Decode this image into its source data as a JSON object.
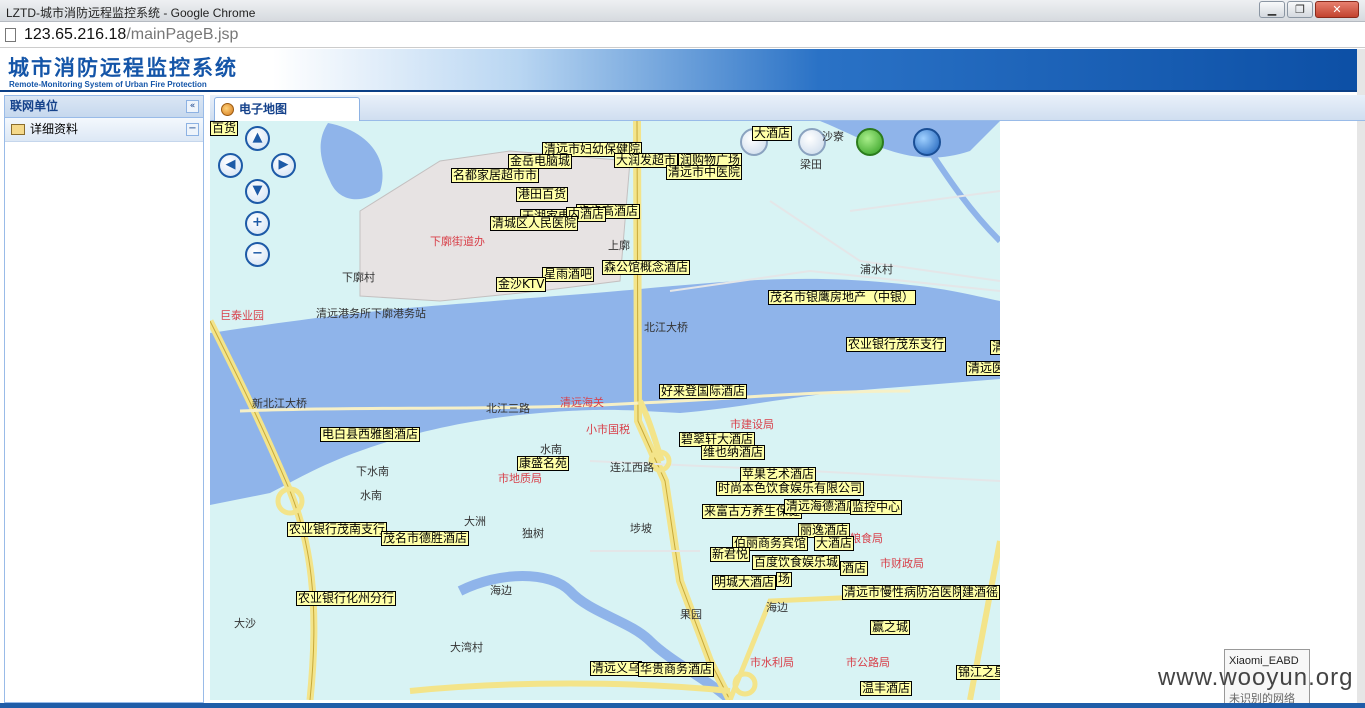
{
  "window": {
    "title": "LZTD-城市消防远程监控系统 - Google Chrome",
    "min": "▁",
    "max": "❐",
    "close": "✕"
  },
  "address": {
    "host": "123.65.216.18",
    "path": "/mainPageB.jsp"
  },
  "banner": {
    "title": "城市消防远程监控系统",
    "subtitle": "Remote-Monitoring System of Urban Fire Protection"
  },
  "sidebar": {
    "title": "联网单位",
    "collapse": "«",
    "items": [
      {
        "label": "详细资料",
        "toggle": "−"
      }
    ]
  },
  "tabs": [
    {
      "label": "电子地图"
    }
  ],
  "map": {
    "controls": {
      "up": "▲",
      "left": "◀",
      "right": "▶",
      "down": "▼",
      "zoom_in": "+",
      "zoom_out": "−"
    },
    "units": [
      "清远市妇幼保健院",
      "金岳电脑城",
      "大润发超市",
      "润购物广场",
      "名都家居超市市",
      "清远市中医院",
      "港田百货",
      "步步高酒店",
      "天湖家电",
      "内酒店",
      "清城区人民医院",
      "森公馆概念酒店",
      "星雨酒吧",
      "金沙KTV",
      "茂名市银鹰房地产（中银）",
      "农业银行茂东支行",
      "清",
      "清远医",
      "好来登国际酒店",
      "电白县西雅图酒店",
      "碧翠轩大酒店",
      "维也纳酒店",
      "康盛名苑",
      "苹果艺术酒店",
      "时尚本色饮食娱乐有限公司",
      "来富古方养生保健",
      "清远海德酒店",
      "监控中心",
      "丽逸酒店",
      "农业银行茂南支行",
      "茂名市德胜酒店",
      "伯丽商务宾馆",
      "大酒店",
      "新君悦",
      "百度饮食娱乐城",
      "明城大酒店",
      "场",
      "酒店",
      "清远市慢性病防治医院",
      "建酒徭",
      "农业银行化州分行",
      "赢之城",
      "清远义乌",
      "华贵商务酒店",
      "锦江之星",
      "温丰酒店",
      "大酒店",
      "百货"
    ],
    "places": [
      {
        "text": "北江大桥",
        "red": false
      },
      {
        "text": "新北江大桥",
        "red": false
      },
      {
        "text": "北江三路",
        "red": false
      },
      {
        "text": "清远海关",
        "red": true
      },
      {
        "text": "市建设局",
        "red": true
      },
      {
        "text": "小市国税",
        "red": true
      },
      {
        "text": "连江西路",
        "red": false
      },
      {
        "text": "下水南",
        "red": false
      },
      {
        "text": "水南",
        "red": false
      },
      {
        "text": "大洲",
        "red": false
      },
      {
        "text": "独树",
        "red": false
      },
      {
        "text": "埗坡",
        "red": false
      },
      {
        "text": "海边",
        "red": false
      },
      {
        "text": "大沙",
        "red": false
      },
      {
        "text": "大湾村",
        "red": false
      },
      {
        "text": "果园",
        "red": false
      },
      {
        "text": "浦水村",
        "red": false
      },
      {
        "text": "粮食局",
        "red": true
      },
      {
        "text": "市财政局",
        "red": true
      },
      {
        "text": "市公路局",
        "red": true
      },
      {
        "text": "清远港务所下廓港务站",
        "red": false
      },
      {
        "text": "巨泰业园",
        "red": true
      },
      {
        "text": "沙寮",
        "red": false
      },
      {
        "text": "梁田",
        "red": false
      },
      {
        "text": "市地质局",
        "red": true
      },
      {
        "text": "市水利局",
        "red": true
      },
      {
        "text": "下廓街道办",
        "red": true
      },
      {
        "text": "上廓",
        "red": false
      },
      {
        "text": "下廓村",
        "red": false
      },
      {
        "text": "水南",
        "red": false
      },
      {
        "text": "海边",
        "red": false
      }
    ]
  },
  "wifi": {
    "name": "Xiaomi_EABD",
    "status": "未识别的网络"
  },
  "watermark": "www.wooyun.org"
}
